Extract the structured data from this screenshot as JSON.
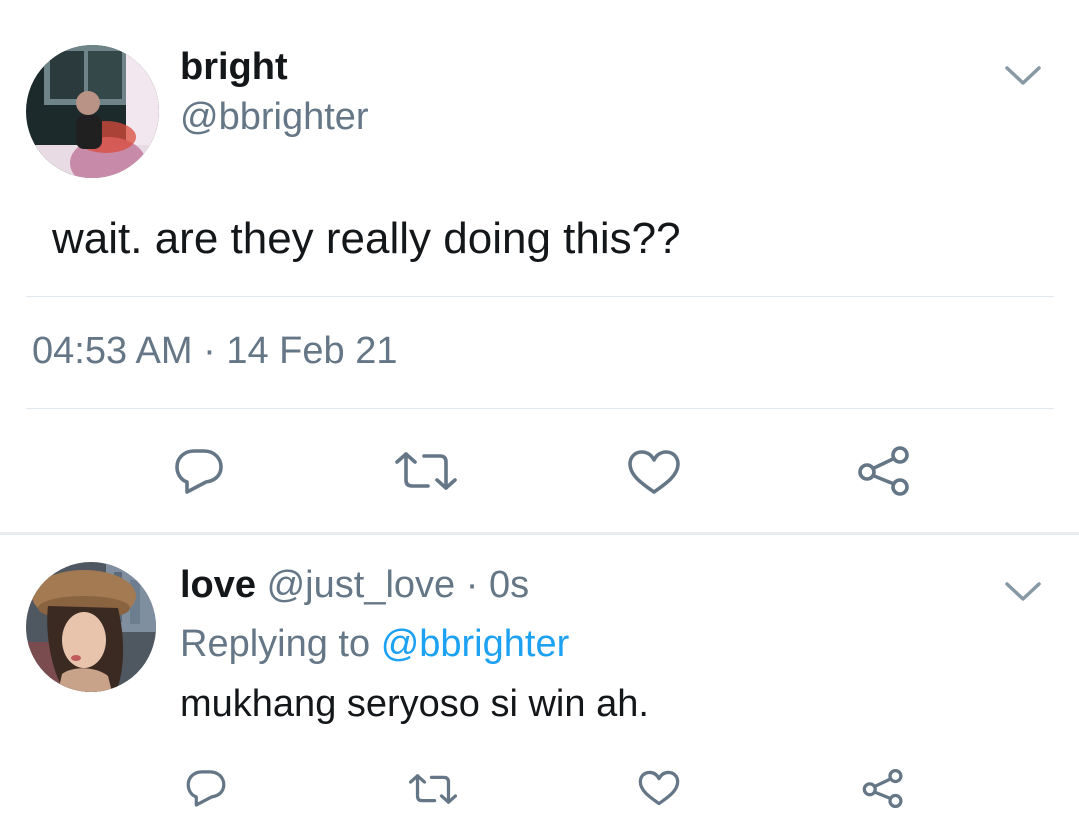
{
  "main_tweet": {
    "display_name": "bright",
    "handle": "@bbrighter",
    "text": "wait. are they really doing this??",
    "time": "04:53 AM",
    "separator": "·",
    "date": "14 Feb 21"
  },
  "reply": {
    "display_name": "love",
    "handle": "@just_love",
    "separator": "·",
    "age": "0s",
    "replying_label": "Replying to",
    "replying_handle": "@bbrighter",
    "text": "mukhang seryoso si win ah."
  },
  "colors": {
    "text": "#14171a",
    "secondary": "#657786",
    "link": "#1da1f2",
    "icon": "#657786",
    "divider": "#e1e8ed"
  },
  "icons": [
    "chevron-down-icon",
    "reply-icon",
    "retweet-icon",
    "like-icon",
    "share-icon"
  ]
}
